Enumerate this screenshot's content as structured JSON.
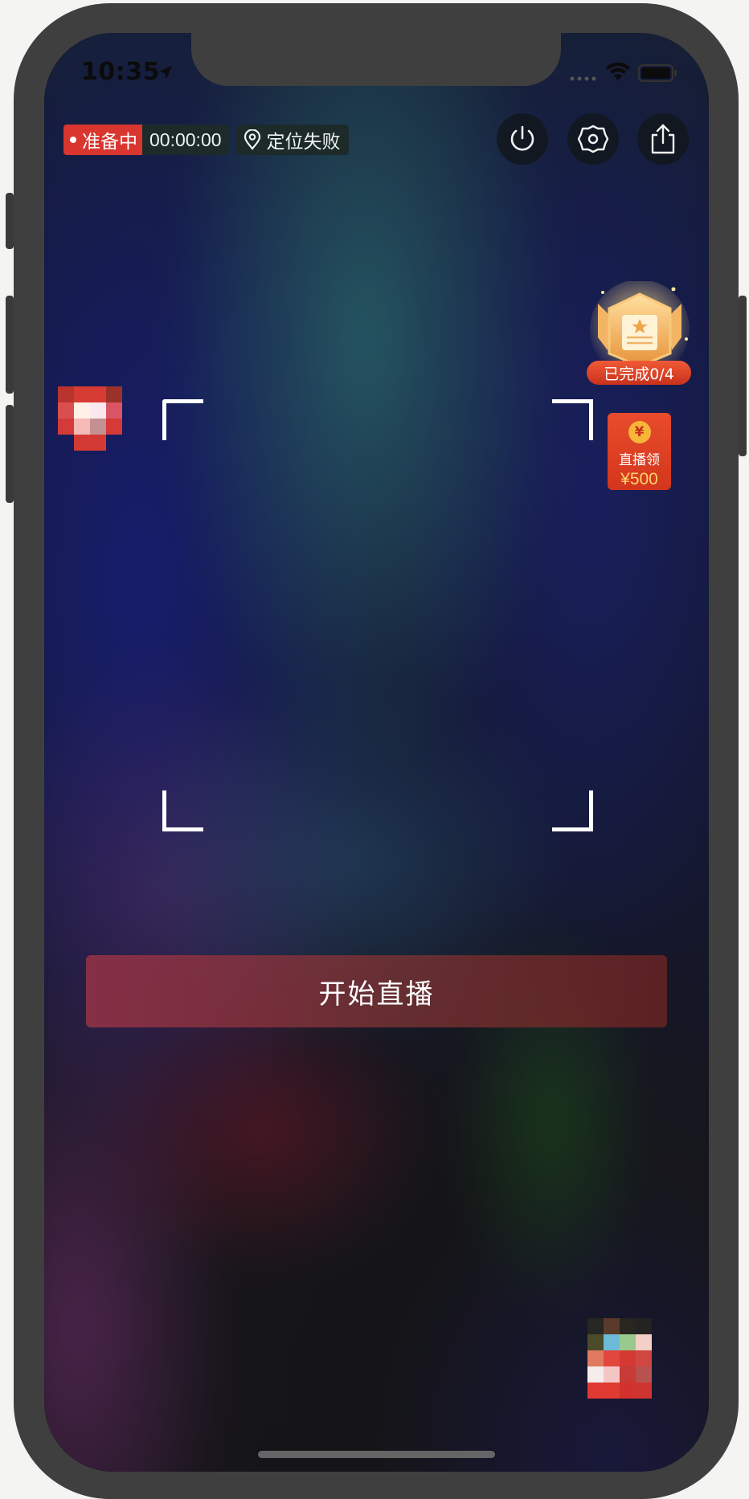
{
  "status_bar": {
    "time": "10:35",
    "icons": [
      "location-arrow-icon",
      "signal-icon",
      "wifi-icon",
      "battery-icon"
    ]
  },
  "live_status": {
    "state_label": "准备中",
    "timer": "00:00:00",
    "location_text": "定位失败",
    "state_color": "#d9362f"
  },
  "top_actions": [
    {
      "name": "power-button",
      "icon": "power-icon"
    },
    {
      "name": "settings-button",
      "icon": "gear-icon"
    },
    {
      "name": "share-button",
      "icon": "share-icon"
    }
  ],
  "task_badge": {
    "label": "已完成0/4",
    "icon": "trophy-badge-icon"
  },
  "red_packet": {
    "symbol": "¥",
    "label": "直播领",
    "amount": "¥500"
  },
  "viewfinder": {
    "icon": "camera-frame-icon"
  },
  "start_button": {
    "label": "开始直播",
    "color": "#8a3346"
  }
}
